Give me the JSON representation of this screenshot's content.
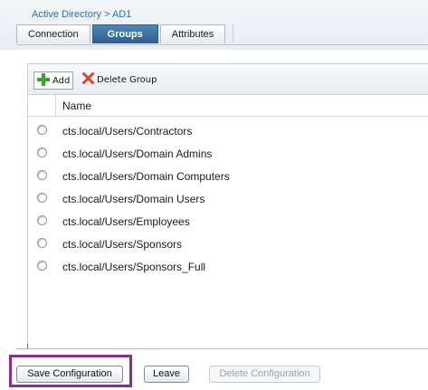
{
  "breadcrumb": "Active Directory > AD1",
  "tabs": [
    {
      "label": "Connection"
    },
    {
      "label": "Groups"
    },
    {
      "label": "Attributes"
    }
  ],
  "toolbar": {
    "add_label": "Add",
    "delete_label": "Delete Group"
  },
  "table": {
    "column_name": "Name",
    "rows": [
      {
        "name": "cts.local/Users/Contractors"
      },
      {
        "name": "cts.local/Users/Domain Admins"
      },
      {
        "name": "cts.local/Users/Domain Computers"
      },
      {
        "name": "cts.local/Users/Domain Users"
      },
      {
        "name": "cts.local/Users/Employees"
      },
      {
        "name": "cts.local/Users/Sponsors"
      },
      {
        "name": "cts.local/Users/Sponsors_Full"
      }
    ]
  },
  "footer": {
    "save_label": "Save Configuration",
    "leave_label": "Leave",
    "delete_label": "Delete Configuration"
  },
  "colors": {
    "active_tab": "#2c5e8f",
    "breadcrumb": "#2f6dae",
    "highlight": "#8b2c96",
    "add_icon": "#3aa52c",
    "delete_icon": "#d9452b"
  }
}
